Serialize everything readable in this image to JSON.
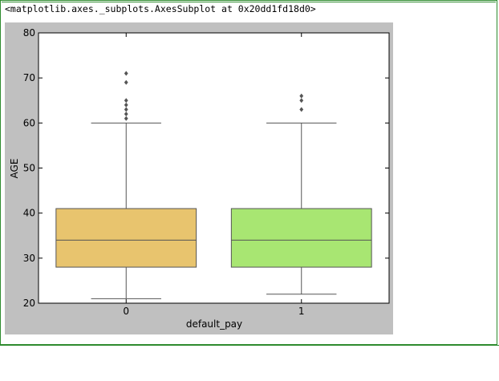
{
  "output": {
    "repr": "<matplotlib.axes._subplots.AxesSubplot at 0x20dd1fd18d0>"
  },
  "colors": {
    "figure_bg": "#c0c0c0",
    "axes_bg": "#ffffff",
    "box_0": "#e8c46e",
    "box_1": "#a8e672",
    "whisker": "#555555",
    "outlier": "#555555",
    "cell_border": "#2e8b2e"
  },
  "chart_data": {
    "type": "box",
    "title": "",
    "xlabel": "default_pay",
    "ylabel": "AGE",
    "ylim": [
      20,
      80
    ],
    "yticks": [
      20,
      30,
      40,
      50,
      60,
      70,
      80
    ],
    "ytick_labels": [
      "20",
      "30",
      "40",
      "50",
      "60",
      "70",
      "80"
    ],
    "categories": [
      "0",
      "1"
    ],
    "grid": false,
    "boxes": [
      {
        "category": "0",
        "whisker_low": 21,
        "q1": 28,
        "median": 34,
        "q3": 41,
        "whisker_high": 60,
        "outliers": [
          61,
          62,
          63,
          64,
          65,
          69,
          71
        ]
      },
      {
        "category": "1",
        "whisker_low": 22,
        "q1": 28,
        "median": 34,
        "q3": 41,
        "whisker_high": 60,
        "outliers": [
          63,
          65,
          66
        ]
      }
    ]
  }
}
